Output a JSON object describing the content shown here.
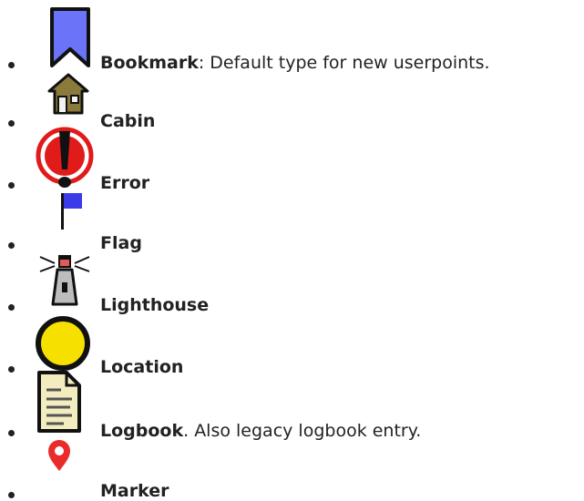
{
  "items": [
    {
      "name": "Bookmark",
      "suffix": ": Default type for new userpoints.",
      "icon": "bookmark-icon"
    },
    {
      "name": "Cabin",
      "suffix": "",
      "icon": "cabin-icon"
    },
    {
      "name": "Error",
      "suffix": "",
      "icon": "error-icon"
    },
    {
      "name": "Flag",
      "suffix": "",
      "icon": "flag-icon"
    },
    {
      "name": "Lighthouse",
      "suffix": "",
      "icon": "lighthouse-icon"
    },
    {
      "name": "Location",
      "suffix": "",
      "icon": "location-icon"
    },
    {
      "name": "Logbook",
      "suffix": ". Also legacy logbook entry.",
      "icon": "logbook-icon"
    },
    {
      "name": "Marker",
      "suffix": "",
      "icon": "marker-icon"
    }
  ]
}
